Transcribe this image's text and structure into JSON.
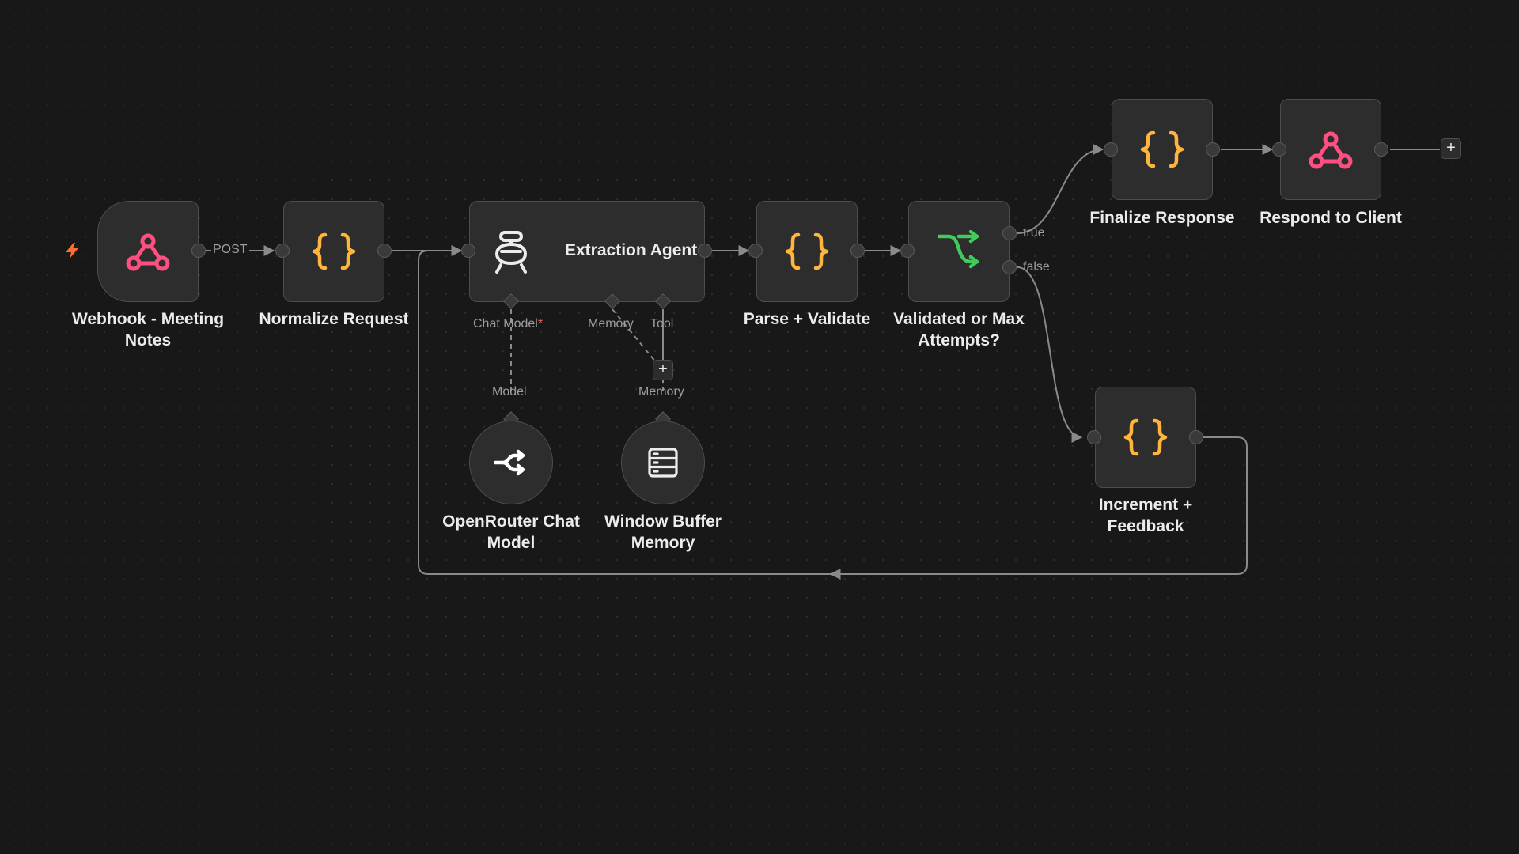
{
  "nodes": {
    "webhook": {
      "label": "Webhook - Meeting Notes"
    },
    "normalize": {
      "label": "Normalize Request"
    },
    "agent": {
      "label": "Extraction Agent"
    },
    "parse": {
      "label": "Parse + Validate"
    },
    "if": {
      "label": "Validated or Max Attempts?"
    },
    "finalize": {
      "label": "Finalize Response"
    },
    "respond": {
      "label": "Respond to Client"
    },
    "increment": {
      "label": "Increment + Feedback"
    },
    "openrouter": {
      "label": "OpenRouter Chat Model"
    },
    "memory": {
      "label": "Window Buffer Memory"
    }
  },
  "edge_labels": {
    "post": "POST",
    "true": "true",
    "false": "false"
  },
  "agent_slots": {
    "chat_model": "Chat Model",
    "required_mark": "*",
    "memory": "Memory",
    "tool": "Tool"
  },
  "sub_slots": {
    "model": "Model",
    "memory": "Memory"
  },
  "buttons": {
    "add": "+"
  },
  "icons": {
    "trigger": "lightning-bolt-icon",
    "webhook": "webhook-icon",
    "code": "curly-braces-icon",
    "agent": "robot-icon",
    "if": "branch-arrows-icon",
    "openrouter": "openrouter-icon",
    "memory": "database-stack-icon"
  },
  "colors": {
    "canvas": "#181818",
    "node": "#2d2d2d",
    "webhook": "#ff4f81",
    "code": "#ffb53d",
    "if": "#3fcc5a",
    "trigger": "#ff6d2e",
    "required": "#ff5d5d",
    "edge": "#8a8a8a"
  }
}
